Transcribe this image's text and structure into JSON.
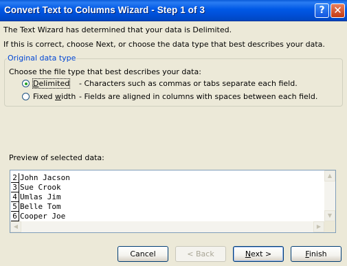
{
  "window": {
    "title": "Convert Text to Columns Wizard - Step 1 of 3",
    "help_icon": "?",
    "close_icon": "✕"
  },
  "intro": {
    "line1": "The Text Wizard has determined that your data is Delimited.",
    "line2": "If this is correct, choose Next, or choose the data type that best describes your data."
  },
  "original_data_type": {
    "legend": "Original data type",
    "prompt": "Choose the file type that best describes your data:",
    "options": [
      {
        "label": "Delimited",
        "description": "- Characters such as commas or tabs separate each field.",
        "selected": true
      },
      {
        "label": "Fixed width",
        "description": "- Fields are aligned in columns with spaces between each field.",
        "selected": false
      }
    ]
  },
  "preview": {
    "label": "Preview of selected data:",
    "rows": [
      {
        "num": "2",
        "text": "John Jacson"
      },
      {
        "num": "3",
        "text": "Sue Crook"
      },
      {
        "num": "4",
        "text": "Umlas Jim"
      },
      {
        "num": "5",
        "text": "Belle Tom"
      },
      {
        "num": "6",
        "text": "Cooper Joe"
      }
    ]
  },
  "buttons": {
    "cancel": "Cancel",
    "back": "< Back",
    "next": "Next >",
    "finish": "Finish"
  }
}
